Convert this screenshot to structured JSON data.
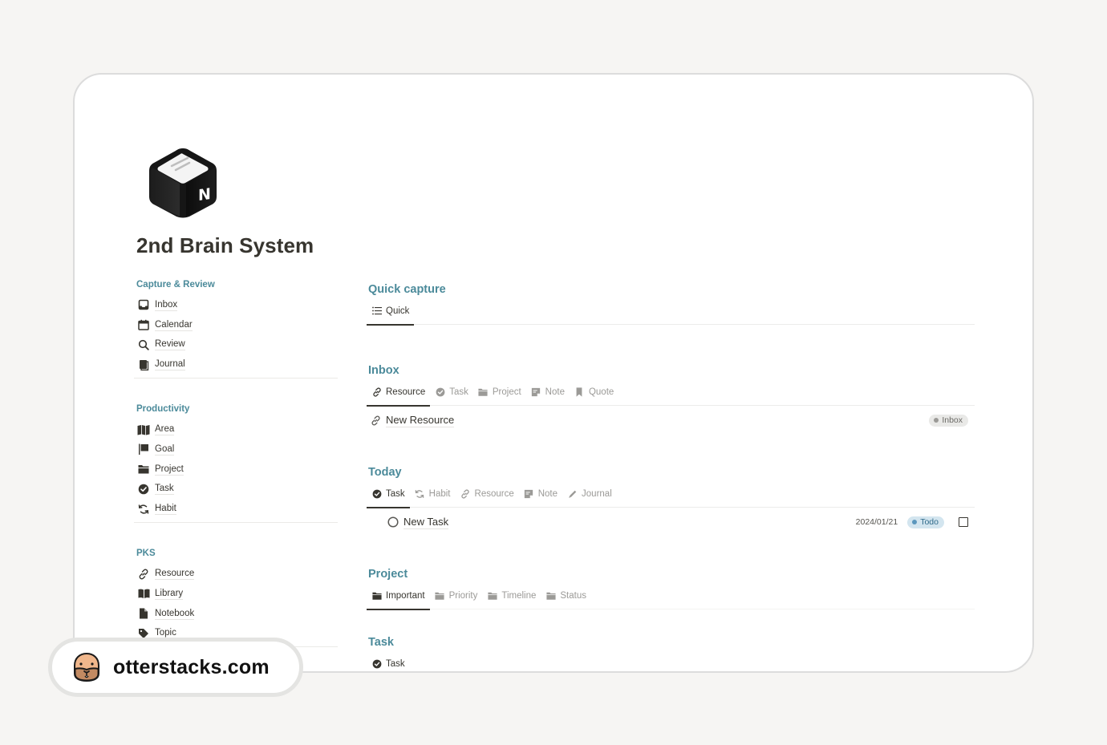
{
  "page": {
    "title": "2nd Brain System",
    "icon": "notion-cube-icon"
  },
  "colors": {
    "background": "#f6f5f3",
    "accent_heading": "#4b8a9a",
    "text": "#37352f",
    "muted_text": "#9b9a97",
    "inbox_pill_bg": "#e9e9e7",
    "inbox_pill_dot": "#9b9a97",
    "todo_pill_bg": "#d3e5ef",
    "todo_pill_dot": "#5b97bd"
  },
  "sidebar": {
    "groups": [
      {
        "heading": "Capture & Review",
        "items": [
          {
            "label": "Inbox",
            "icon": "inbox-tray-icon"
          },
          {
            "label": "Calendar",
            "icon": "calendar-icon"
          },
          {
            "label": "Review",
            "icon": "search-icon"
          },
          {
            "label": "Journal",
            "icon": "journal-book-icon"
          }
        ]
      },
      {
        "heading": "Productivity",
        "items": [
          {
            "label": "Area",
            "icon": "map-icon"
          },
          {
            "label": "Goal",
            "icon": "flag-icon"
          },
          {
            "label": "Project",
            "icon": "folder-icon"
          },
          {
            "label": "Task",
            "icon": "check-circle-icon"
          },
          {
            "label": "Habit",
            "icon": "repeat-icon"
          }
        ]
      },
      {
        "heading": "PKS",
        "items": [
          {
            "label": "Resource",
            "icon": "link-icon"
          },
          {
            "label": "Library",
            "icon": "open-book-icon"
          },
          {
            "label": "Notebook",
            "icon": "document-icon"
          },
          {
            "label": "Topic",
            "icon": "tag-icon"
          }
        ]
      }
    ]
  },
  "main": {
    "sections": [
      {
        "title": "Quick capture",
        "tabs": [
          {
            "label": "Quick",
            "icon": "list-icon",
            "active": true
          }
        ],
        "rows": []
      },
      {
        "title": "Inbox",
        "tabs": [
          {
            "label": "Resource",
            "icon": "link-icon",
            "active": true
          },
          {
            "label": "Task",
            "icon": "check-circle-icon",
            "active": false
          },
          {
            "label": "Project",
            "icon": "folder-icon",
            "active": false
          },
          {
            "label": "Note",
            "icon": "note-icon",
            "active": false
          },
          {
            "label": "Quote",
            "icon": "bookmark-icon",
            "active": false
          }
        ],
        "rows": [
          {
            "title": "New Resource",
            "icon": "link-icon",
            "status": "Inbox"
          }
        ]
      },
      {
        "title": "Today",
        "tabs": [
          {
            "label": "Task",
            "icon": "check-circle-icon",
            "active": true
          },
          {
            "label": "Habit",
            "icon": "repeat-icon",
            "active": false
          },
          {
            "label": "Resource",
            "icon": "link-icon",
            "active": false
          },
          {
            "label": "Note",
            "icon": "note-icon",
            "active": false
          },
          {
            "label": "Journal",
            "icon": "pencil-icon",
            "active": false
          }
        ],
        "rows": [
          {
            "title": "New Task",
            "icon": "circle-icon",
            "date": "2024/01/21",
            "status": "Todo",
            "checked": false
          }
        ]
      },
      {
        "title": "Project",
        "tabs": [
          {
            "label": "Important",
            "icon": "folder-icon",
            "active": true
          },
          {
            "label": "Priority",
            "icon": "folder-icon",
            "active": false
          },
          {
            "label": "Timeline",
            "icon": "folder-icon",
            "active": false
          },
          {
            "label": "Status",
            "icon": "folder-icon",
            "active": false
          }
        ],
        "rows": []
      },
      {
        "title": "Task",
        "tabs": [
          {
            "label": "Task",
            "icon": "check-circle-icon",
            "active": true
          }
        ],
        "rows": []
      }
    ]
  },
  "watermark": {
    "site": "otterstacks.com",
    "icon": "otter-face-icon"
  }
}
